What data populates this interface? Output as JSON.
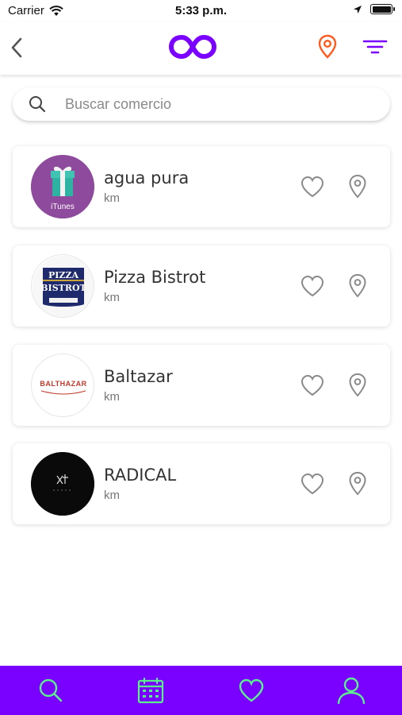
{
  "status_bar": {
    "carrier": "Carrier",
    "time": "5:33 p.m."
  },
  "nav": {
    "back_icon": "chevron-left-icon",
    "logo_icon": "infinity-logo",
    "location_icon": "map-pin-icon",
    "filter_icon": "filter-icon"
  },
  "search": {
    "placeholder": "Buscar comercio",
    "value": ""
  },
  "stores": [
    {
      "name": "agua pura",
      "distance": "km",
      "logo": "itunes-gift-logo",
      "logo_caption": "iTunes"
    },
    {
      "name": "Pizza Bistrot",
      "distance": "km",
      "logo": "pizza-bistrot-logo",
      "logo_line1": "PIZZA",
      "logo_line2": "BISTROT"
    },
    {
      "name": "Baltazar",
      "distance": "km",
      "logo": "baltazar-logo",
      "logo_text": "BALTHAZAR"
    },
    {
      "name": "RADICAL",
      "distance": "km",
      "logo": "radical-logo"
    }
  ],
  "tabs": [
    {
      "icon": "search-icon"
    },
    {
      "icon": "calendar-icon"
    },
    {
      "icon": "heart-icon"
    },
    {
      "icon": "profile-icon"
    }
  ],
  "colors": {
    "brand_purple": "#7a00ff",
    "accent_orange": "#ff5a1f",
    "tab_icon_green": "#5cf08c",
    "icon_gray": "#8a8a8a"
  }
}
